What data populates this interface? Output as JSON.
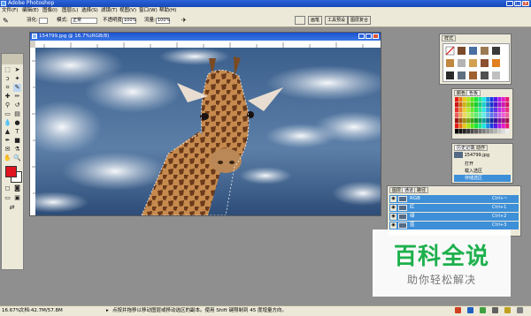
{
  "window": {
    "title": "Adobe Photoshop"
  },
  "menu": [
    "文件(F)",
    "编辑(E)",
    "图像(I)",
    "图层(L)",
    "选择(S)",
    "滤镜(T)",
    "视图(V)",
    "窗口(W)",
    "帮助(H)"
  ],
  "options": {
    "feather_label": "羽化:",
    "mode_label": "模式:",
    "mode_value": "正常",
    "opacity_label": "不透明度:",
    "opacity_value": "100%",
    "flow_label": "流量:",
    "flow_value": "100%"
  },
  "top_tabs": [
    "画笔",
    "工具预设",
    "图层复合"
  ],
  "document": {
    "title": "154799.jpg @ 16.7%(RGB/8)"
  },
  "palettes": {
    "styles_tab": "样式",
    "color_tabs": [
      "颜色",
      "色板"
    ],
    "history_tabs": [
      "历史记录",
      "动作"
    ],
    "history_file": "154799.jpg",
    "history_items": [
      "打开",
      "载入选区",
      "存储选区"
    ],
    "layer_tabs": [
      "图层",
      "通道",
      "路径"
    ],
    "channels": [
      {
        "name": "RGB",
        "shortcut": "Ctrl+~"
      },
      {
        "name": "红",
        "shortcut": "Ctrl+1"
      },
      {
        "name": "绿",
        "shortcut": "Ctrl+2"
      },
      {
        "name": "蓝",
        "shortcut": "Ctrl+3"
      }
    ]
  },
  "status": {
    "zoom": "16.67%",
    "doc": "文档:42.7M/57.8M",
    "hint": "点按并拖移以移动图层或移动选区的副本。使用 Shift 键限制到 45 度增量方向。"
  },
  "watermark": {
    "main": "百科全说",
    "sub": "助你轻松解决"
  },
  "colors": {
    "foreground": "#e0141e",
    "titlebar": "#1646b8",
    "chrome": "#ece9d8",
    "selection": "#3d8fd8",
    "watermark": "#1db04c"
  }
}
